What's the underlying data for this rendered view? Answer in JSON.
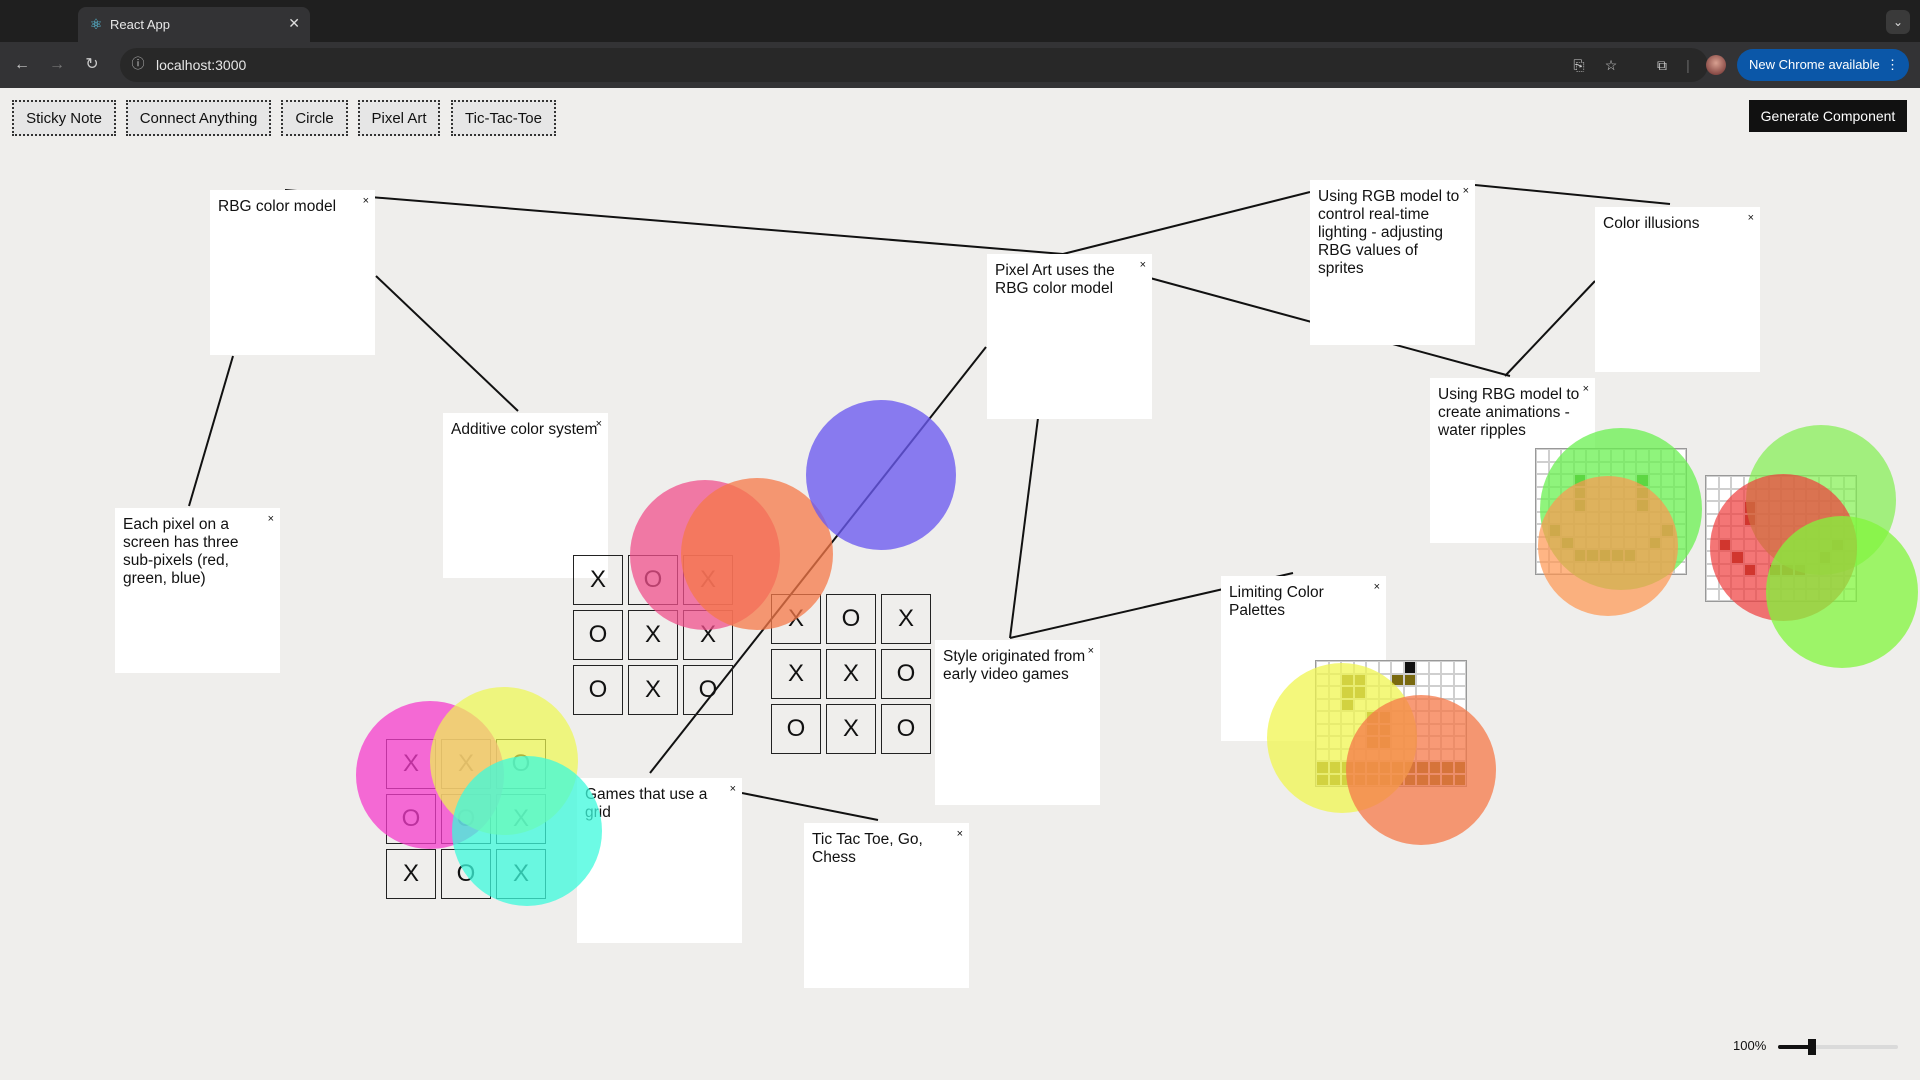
{
  "browser": {
    "tab_title": "React App",
    "tab_icon": "react-icon",
    "url": "localhost:3000",
    "update_label": "New Chrome available"
  },
  "toolbar": {
    "buttons": [
      {
        "label": "Sticky Note"
      },
      {
        "label": "Connect Anything"
      },
      {
        "label": "Circle"
      },
      {
        "label": "Pixel Art"
      },
      {
        "label": "Tic-Tac-Toe"
      }
    ],
    "generate_label": "Generate Component"
  },
  "notes": [
    {
      "id": "rbg",
      "text": "RBG color model"
    },
    {
      "id": "pixel-art",
      "text": "Pixel Art uses the RBG color model"
    },
    {
      "id": "rgb-lighting",
      "text": "Using RGB model to control real-time lighting - adjusting RBG values of sprites"
    },
    {
      "id": "illusions",
      "text": "Color illusions"
    },
    {
      "id": "additive",
      "text": "Additive color system"
    },
    {
      "id": "subpixels",
      "text": "Each pixel on a screen has three sub-pixels (red, green, blue)"
    },
    {
      "id": "ripples",
      "text": "Using RBG model to create animations - water ripples"
    },
    {
      "id": "palettes",
      "text": "Limiting Color Palettes"
    },
    {
      "id": "video-games",
      "text": "Style originated from early video games"
    },
    {
      "id": "grid-games",
      "text": "Games that use a grid"
    },
    {
      "id": "tictactoe-go",
      "text": "Tic Tac Toe, Go, Chess"
    }
  ],
  "close_symbol": "×",
  "boards": [
    [
      "X",
      "O",
      "X",
      "O",
      "X",
      "X",
      "O",
      "X",
      "O"
    ],
    [
      "X",
      "O",
      "X",
      "X",
      "X",
      "O",
      "O",
      "X",
      "O"
    ],
    [
      "X",
      "X",
      "O",
      "O",
      "O",
      "X",
      "X",
      "O",
      "X"
    ]
  ],
  "colors": {
    "pink": "#f0508c",
    "salmon": "#f57848",
    "purple": "#6a5af0",
    "magenta": "#f53ccc",
    "yellow": "#eef850",
    "teal": "#3cfadc",
    "green": "#6af050",
    "orange": "#ff9650",
    "red": "#f03c3c"
  },
  "zoom": {
    "label": "100%",
    "value": 0.28
  }
}
